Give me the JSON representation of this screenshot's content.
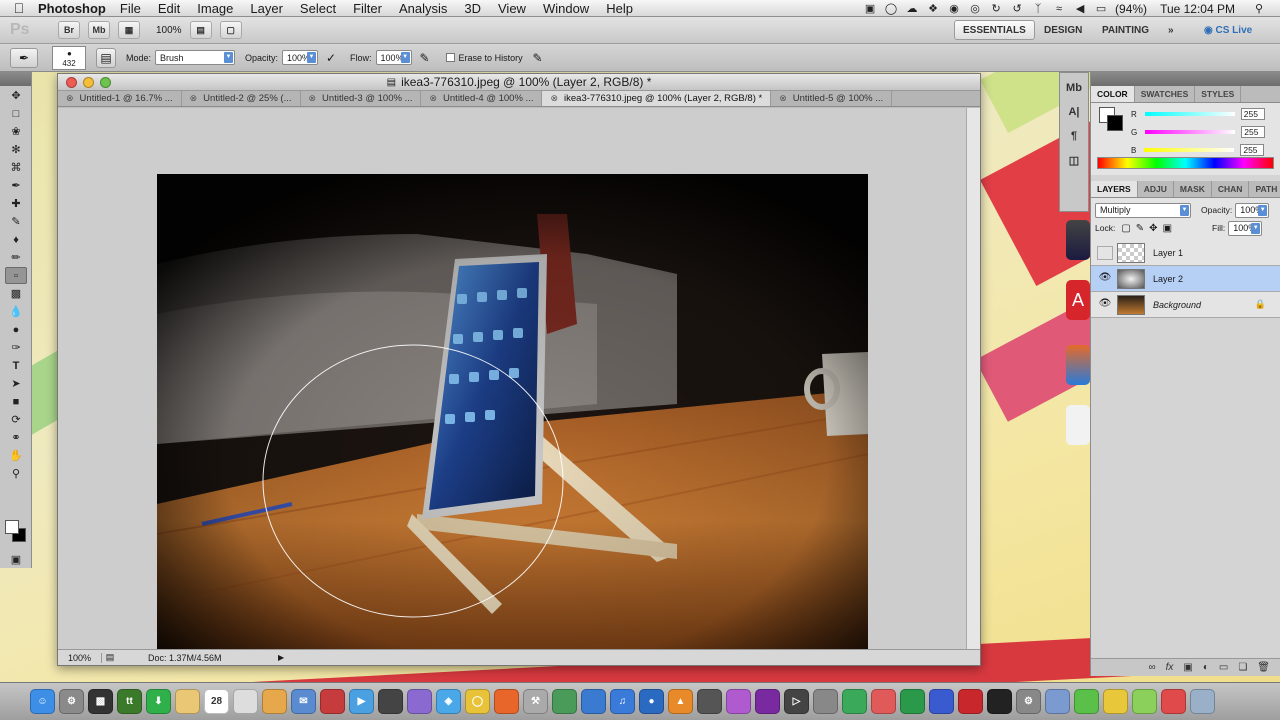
{
  "menubar": {
    "app": "Photoshop",
    "items": [
      "File",
      "Edit",
      "Image",
      "Layer",
      "Select",
      "Filter",
      "Analysis",
      "3D",
      "View",
      "Window",
      "Help"
    ],
    "battery": "(94%)",
    "clock": "Tue 12:04 PM"
  },
  "appbar": {
    "logo": "Ps",
    "zoom": "100%",
    "workspaces": [
      "ESSENTIALS",
      "DESIGN",
      "PAINTING"
    ],
    "cs_live": "CS Live"
  },
  "options": {
    "brush_size": "432",
    "mode_label": "Mode:",
    "mode_value": "Brush",
    "opacity_label": "Opacity:",
    "opacity_value": "100%",
    "flow_label": "Flow:",
    "flow_value": "100%",
    "erase_label": "Erase to History"
  },
  "document": {
    "title": "ikea3-776310.jpeg @ 100% (Layer 2, RGB/8) *",
    "tabs": [
      "Untitled-1 @ 16.7% ...",
      "Untitled-2 @ 25% (...",
      "Untitled-3 @ 100% ...",
      "Untitled-4 @ 100% ...",
      "ikea3-776310.jpeg @ 100% (Layer 2, RGB/8) *",
      "Untitled-5 @ 100% ..."
    ],
    "zoom_status": "100%",
    "doc_info": "Doc: 1.37M/4.56M"
  },
  "color_panel": {
    "tabs": [
      "COLOR",
      "SWATCHES",
      "STYLES"
    ],
    "r_label": "R",
    "g_label": "G",
    "b_label": "B",
    "r": "255",
    "g": "255",
    "b": "255"
  },
  "layers_panel": {
    "tabs": [
      "LAYERS",
      "ADJU",
      "MASK",
      "CHAN",
      "PATH"
    ],
    "blend_mode": "Multiply",
    "opacity_label": "Opacity:",
    "opacity": "100%",
    "lock_label": "Lock:",
    "fill_label": "Fill:",
    "fill": "100%",
    "layers": [
      {
        "name": "Layer 1",
        "visible": false,
        "selected": false
      },
      {
        "name": "Layer 2",
        "visible": true,
        "selected": true
      },
      {
        "name": "Background",
        "visible": true,
        "selected": false
      }
    ]
  },
  "dock": {
    "calendar_day": "28"
  },
  "colors": {
    "selection": "#b5cff5",
    "wallpaper_red": "#e23e46",
    "wallpaper_yellow": "#f1e39a"
  }
}
